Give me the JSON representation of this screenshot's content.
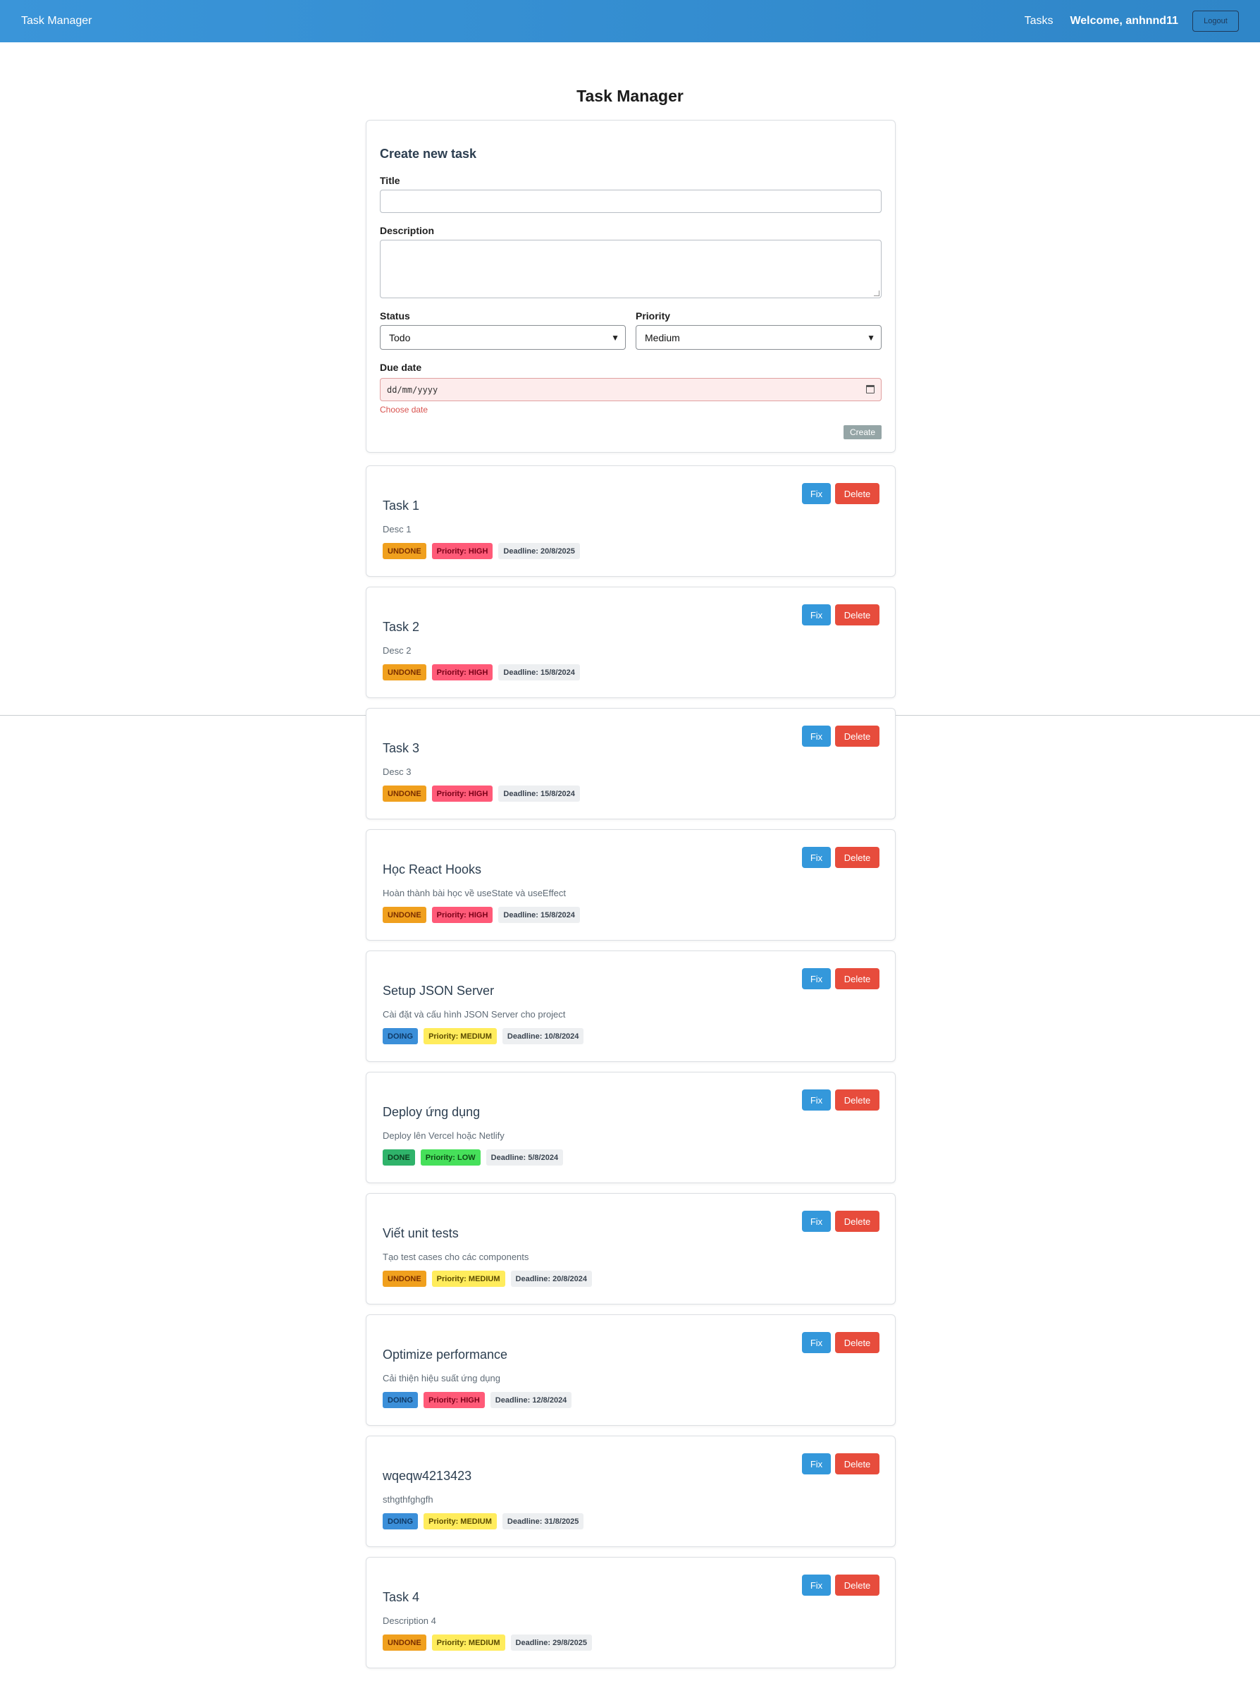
{
  "navbar": {
    "brand": "Task Manager",
    "tasks_link": "Tasks",
    "welcome": "Welcome, anhnnd11",
    "logout": "Logout",
    "gradient_start": "#3a95d9",
    "gradient_end": "#2f86c8"
  },
  "page": {
    "title": "Task Manager"
  },
  "form": {
    "heading": "Create new task",
    "title_label": "Title",
    "title_value": "",
    "description_label": "Description",
    "description_value": "",
    "status_label": "Status",
    "status_value": "Todo",
    "priority_label": "Priority",
    "priority_value": "Medium",
    "due_label": "Due date",
    "due_placeholder": "dd/mm/yyyy",
    "due_error": "Choose date",
    "create_label": "Create"
  },
  "actions": {
    "fix": "Fix",
    "delete": "Delete"
  },
  "colors": {
    "fix": "#3498db",
    "delete": "#e74c3c",
    "undone": "#f0a01e",
    "doing": "#3b8fd9",
    "done": "#2fb36a",
    "high": "#ff5a78",
    "medium": "#ffec5c",
    "low": "#46e05a"
  },
  "tasks": [
    {
      "title": "Task 1",
      "desc": "Desc 1",
      "status": "UNDONE",
      "status_kind": "undone",
      "priority": "Priority: HIGH",
      "priority_kind": "high",
      "deadline": "Deadline: 20/8/2025"
    },
    {
      "title": "Task 2",
      "desc": "Desc 2",
      "status": "UNDONE",
      "status_kind": "undone",
      "priority": "Priority: HIGH",
      "priority_kind": "high",
      "deadline": "Deadline: 15/8/2024"
    },
    {
      "title": "Task 3",
      "desc": "Desc 3",
      "status": "UNDONE",
      "status_kind": "undone",
      "priority": "Priority: HIGH",
      "priority_kind": "high",
      "deadline": "Deadline: 15/8/2024"
    },
    {
      "title": "Học React Hooks",
      "desc": "Hoàn thành bài học về useState và useEffect",
      "status": "UNDONE",
      "status_kind": "undone",
      "priority": "Priority: HIGH",
      "priority_kind": "high",
      "deadline": "Deadline: 15/8/2024"
    },
    {
      "title": "Setup JSON Server",
      "desc": "Cài đặt và cấu hình JSON Server cho project",
      "status": "DOING",
      "status_kind": "doing",
      "priority": "Priority: MEDIUM",
      "priority_kind": "medium",
      "deadline": "Deadline: 10/8/2024"
    },
    {
      "title": "Deploy ứng dụng",
      "desc": "Deploy lên Vercel hoặc Netlify",
      "status": "DONE",
      "status_kind": "done",
      "priority": "Priority: LOW",
      "priority_kind": "low",
      "deadline": "Deadline: 5/8/2024"
    },
    {
      "title": "Viết unit tests",
      "desc": "Tạo test cases cho các components",
      "status": "UNDONE",
      "status_kind": "undone",
      "priority": "Priority: MEDIUM",
      "priority_kind": "medium",
      "deadline": "Deadline: 20/8/2024"
    },
    {
      "title": "Optimize performance",
      "desc": "Cải thiện hiệu suất ứng dụng",
      "status": "DOING",
      "status_kind": "doing",
      "priority": "Priority: HIGH",
      "priority_kind": "high",
      "deadline": "Deadline: 12/8/2024"
    },
    {
      "title": "wqeqw4213423",
      "desc": "sthgthfghgfh",
      "status": "DOING",
      "status_kind": "doing",
      "priority": "Priority: MEDIUM",
      "priority_kind": "medium",
      "deadline": "Deadline: 31/8/2025"
    },
    {
      "title": "Task 4",
      "desc": "Description 4",
      "status": "UNDONE",
      "status_kind": "undone",
      "priority": "Priority: MEDIUM",
      "priority_kind": "medium",
      "deadline": "Deadline: 29/8/2025"
    }
  ]
}
